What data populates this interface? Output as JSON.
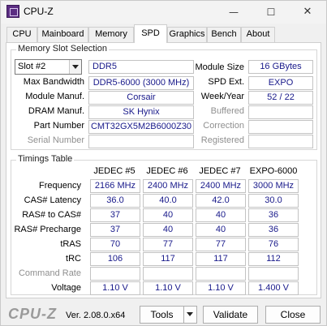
{
  "window": {
    "title": "CPU-Z",
    "min_glyph": "—",
    "max_glyph": "☐",
    "close_glyph": "✕",
    "icon": "cpu-z-app-icon"
  },
  "tabs": [
    {
      "label": "CPU"
    },
    {
      "label": "Mainboard"
    },
    {
      "label": "Memory"
    },
    {
      "label": "SPD"
    },
    {
      "label": "Graphics"
    },
    {
      "label": "Bench"
    },
    {
      "label": "About"
    }
  ],
  "active_tab": "SPD",
  "slot": {
    "title": "Memory Slot Selection",
    "selected": "Slot #2",
    "memory_type": "DDR5",
    "max_bandwidth_label": "Max Bandwidth",
    "max_bandwidth": "DDR5-6000 (3000 MHz)",
    "module_manuf_label": "Module Manuf.",
    "module_manuf": "Corsair",
    "dram_manuf_label": "DRAM Manuf.",
    "dram_manuf": "SK Hynix",
    "part_number_label": "Part Number",
    "part_number": "CMT32GX5M2B6000Z30",
    "serial_number_label": "Serial Number",
    "serial_number": "",
    "module_size_label": "Module Size",
    "module_size": "16 GBytes",
    "spd_ext_label": "SPD Ext.",
    "spd_ext": "EXPO",
    "week_year_label": "Week/Year",
    "week_year": "52 / 22",
    "buffered_label": "Buffered",
    "buffered": "",
    "correction_label": "Correction",
    "correction": "",
    "registered_label": "Registered",
    "registered": ""
  },
  "timings": {
    "title": "Timings Table",
    "columns": [
      "JEDEC #5",
      "JEDEC #6",
      "JEDEC #7",
      "EXPO-6000"
    ],
    "rows": [
      {
        "label": "Frequency",
        "values": [
          "2166 MHz",
          "2400 MHz",
          "2400 MHz",
          "3000 MHz"
        ]
      },
      {
        "label": "CAS# Latency",
        "values": [
          "36.0",
          "40.0",
          "42.0",
          "30.0"
        ]
      },
      {
        "label": "RAS# to CAS#",
        "values": [
          "37",
          "40",
          "40",
          "36"
        ]
      },
      {
        "label": "RAS# Precharge",
        "values": [
          "37",
          "40",
          "40",
          "36"
        ]
      },
      {
        "label": "tRAS",
        "values": [
          "70",
          "77",
          "77",
          "76"
        ]
      },
      {
        "label": "tRC",
        "values": [
          "106",
          "117",
          "117",
          "112"
        ]
      },
      {
        "label": "Command Rate",
        "values": [
          "",
          "",
          "",
          ""
        ]
      },
      {
        "label": "Voltage",
        "values": [
          "1.10 V",
          "1.10 V",
          "1.10 V",
          "1.400 V"
        ]
      }
    ]
  },
  "footer": {
    "logo": "CPU-Z",
    "version": "Ver. 2.08.0.x64",
    "tools_label": "Tools",
    "validate_label": "Validate",
    "close_label": "Close"
  }
}
